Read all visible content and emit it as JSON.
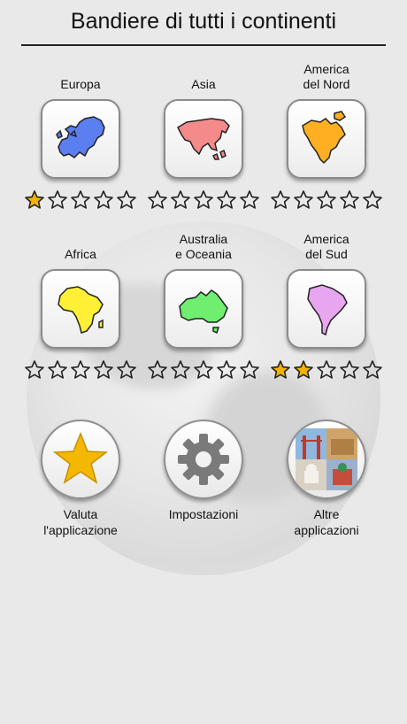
{
  "header": {
    "title": "Bandiere di tutti i continenti"
  },
  "colors": {
    "star_filled": "#f2b300",
    "star_outline": "#222222",
    "europe": "#5b7ff0",
    "asia": "#f48a8a",
    "north_america": "#ffb022",
    "africa": "#fff035",
    "oceania": "#6fee6f",
    "south_america": "#e8a5f0"
  },
  "continents": [
    {
      "label": "Europa",
      "icon": "europe-map-icon",
      "stars": 1
    },
    {
      "label": "Asia",
      "icon": "asia-map-icon",
      "stars": 0
    },
    {
      "label": "America\ndel Nord",
      "icon": "north-america-map-icon",
      "stars": 0
    },
    {
      "label": "Africa",
      "icon": "africa-map-icon",
      "stars": 0
    },
    {
      "label": "Australia\ne Oceania",
      "icon": "oceania-map-icon",
      "stars": 0
    },
    {
      "label": "America\ndel Sud",
      "icon": "south-america-map-icon",
      "stars": 2
    }
  ],
  "stars_max": 5,
  "bottom": [
    {
      "label": "Valuta\nl'applicazione",
      "icon": "star-icon"
    },
    {
      "label": "Impostazioni",
      "icon": "gear-icon"
    },
    {
      "label": "Altre\napplicazioni",
      "icon": "landmarks-collage-icon"
    }
  ]
}
